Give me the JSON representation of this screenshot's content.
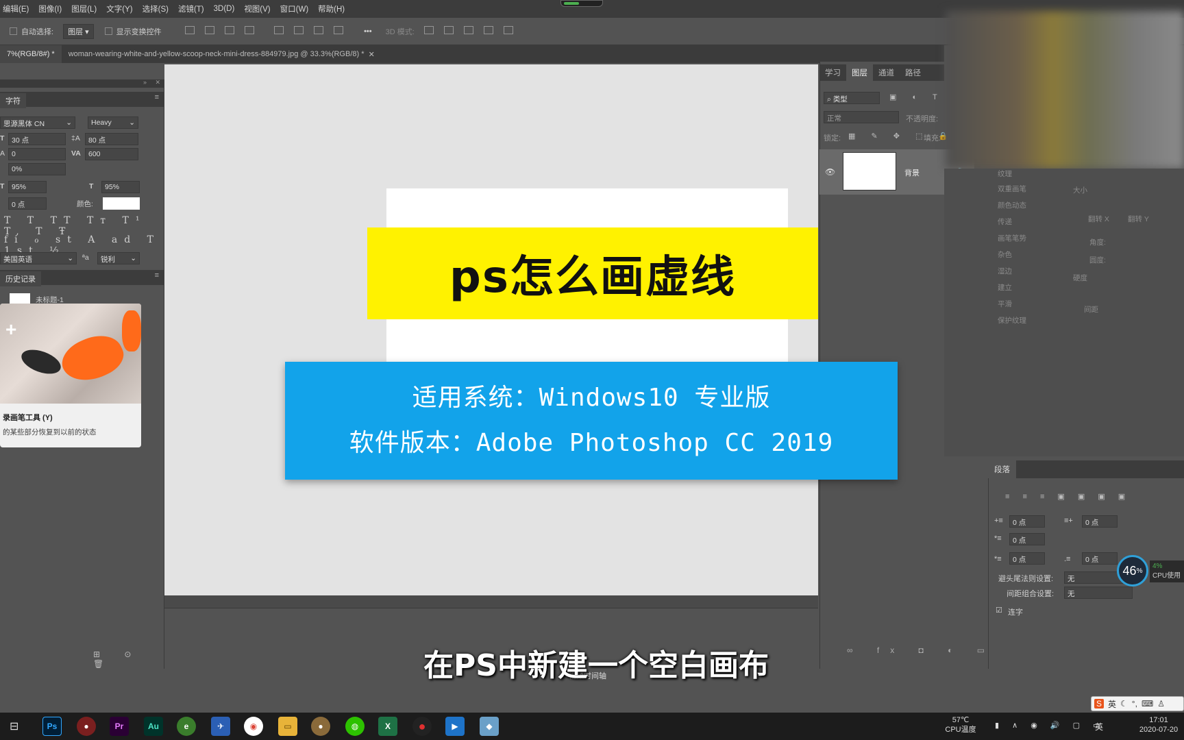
{
  "menu": [
    "编辑(E)",
    "图像(I)",
    "图层(L)",
    "文字(Y)",
    "选择(S)",
    "滤镜(T)",
    "3D(D)",
    "视图(V)",
    "窗口(W)",
    "帮助(H)"
  ],
  "options": {
    "auto_select": "自动选择:",
    "target": "图层",
    "show_transform": "显示变换控件",
    "more": "•••",
    "mode_3d": "3D 模式:"
  },
  "tabs": {
    "first": "7%(RGB/8#) *",
    "second": "woman-wearing-white-and-yellow-scoop-neck-mini-dress-884979.jpg @ 33.3%(RGB/8) *"
  },
  "character": {
    "tab": "字符",
    "font": "思源黑体 CN",
    "style": "Heavy",
    "size": "30 点",
    "leading": "80 点",
    "kerning": "0",
    "tracking": "600",
    "scale_pct": "0%",
    "vscale": "95%",
    "hscale": "95%",
    "baseline": "0 点",
    "color_label": "颜色:",
    "language": "美国英语",
    "aa_icon": "ªa",
    "antialias": "锐利",
    "glyph_row1": "T T TT Tт T¹ T, T Ŧ",
    "glyph_row2": "fi ℴ st A ad T 1st ½"
  },
  "history": {
    "tab": "历史记录",
    "item": "未标题-1"
  },
  "tooltip": {
    "title": "录画笔工具 (Y)",
    "desc": "的某些部分恢复到以前的状态"
  },
  "overlay": {
    "title": "ps怎么画虚线",
    "line1": "适用系统：Windows10 专业版",
    "line2": "软件版本：Adobe Photoshop CC 2019",
    "subtitle": "在PS中新建一个空白画布",
    "timeline_btn": "视频时间轴"
  },
  "layers": {
    "tabs": [
      "学习",
      "图层",
      "通道",
      "路径"
    ],
    "active_tab": "图层",
    "kind": "类型",
    "blend": "正常",
    "opacity_label": "不透明度:",
    "lock_label": "锁定:",
    "fill_label": "填充:",
    "layer_name": "背景"
  },
  "brush_panel": {
    "items": [
      "纹理",
      "双重画笔",
      "颜色动态",
      "传递",
      "画笔笔势",
      "杂色",
      "湿边",
      "建立",
      "平滑",
      "保护纹理"
    ],
    "size_label": "大小",
    "flip_x": "翻转 X",
    "flip_y": "翻转 Y",
    "angle": "角度:",
    "roundness": "圆度:",
    "hardness": "硬度",
    "spacing": "间距"
  },
  "paragraph": {
    "tab": "段落",
    "indent_left": "0 点",
    "indent_right": "0 点",
    "first_line": "0 点",
    "space_before": "0 点",
    "space_after": "0 点",
    "kinsoku_label": "避头尾法则设置:",
    "kinsoku_value": "无",
    "mojikumi_label": "间距组合设置:",
    "mojikumi_value": "无",
    "hyphenate": "连字"
  },
  "cpu": {
    "percent": "46",
    "unit": "%",
    "side_pct": "4%",
    "side_label": "CPU使用"
  },
  "taskbar": {
    "temp": "57℃",
    "temp_label": "CPU温度",
    "lang": "英",
    "time": "17:01",
    "date": "2020-07-20",
    "ime_lang": "英"
  },
  "colors": {
    "yellow": "#fff200",
    "blue": "#12a3ea",
    "ps_icon": "#001e36",
    "pr_icon": "#2a0034",
    "au_icon": "#00332a"
  }
}
